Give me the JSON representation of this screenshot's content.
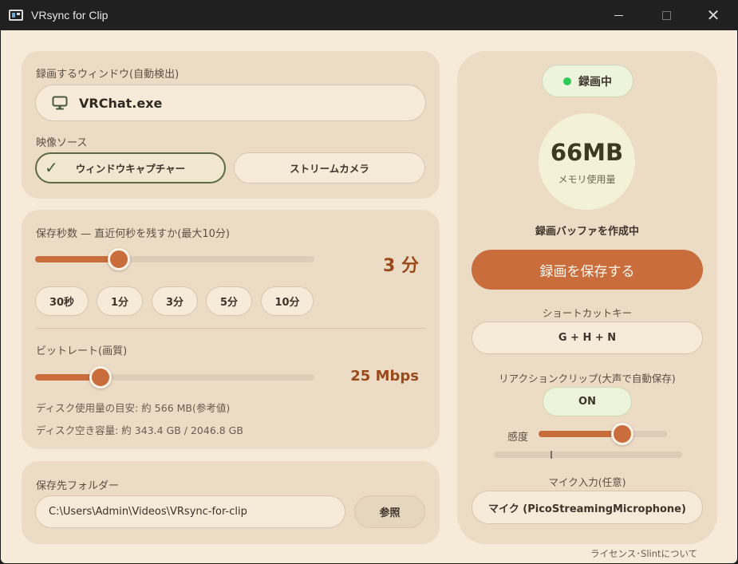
{
  "window": {
    "title": "VRsync for Clip",
    "minimize": "",
    "maximize": "",
    "close": "✕"
  },
  "capture": {
    "window_label": "録画するウィンドウ(自動検出)",
    "window_value": "VRChat.exe",
    "source_label": "映像ソース",
    "source_window_capture": "ウィンドウキャプチャー",
    "source_stream_camera": "ストリームカメラ",
    "selected_source": "ウィンドウキャプチャー",
    "check_glyph": "✓"
  },
  "retention": {
    "label": "保存秒数 — 直近何秒を残すか(最大10分)",
    "value_text": "3 分",
    "value_fraction": 0.3,
    "presets": [
      "30秒",
      "1分",
      "3分",
      "5分",
      "10分"
    ]
  },
  "bitrate": {
    "label": "ビットレート(画質)",
    "value_text": "25 Mbps",
    "value_fraction": 0.234,
    "disk_estimate": "ディスク使用量の目安: 約 566 MB(参考値)",
    "disk_free": "ディスク空き容量: 約 343.4 GB / 2046.8 GB"
  },
  "folder": {
    "label": "保存先フォルダー",
    "path": "C:\\Users\\Admin\\Videos\\VRsync-for-clip",
    "browse": "参照"
  },
  "status": {
    "recording": "録画中",
    "memory_value": "66MB",
    "memory_label": "メモリ使用量",
    "buffer_status": "録画バッファを作成中",
    "save_button": "録画を保存する",
    "indicator_color": "#2ecc57"
  },
  "shortcut": {
    "label": "ショートカットキー",
    "value": "G + H + N"
  },
  "reaction": {
    "label": "リアクションクリップ(大声で自動保存)",
    "toggle": "ON",
    "sensitivity_label": "感度",
    "sensitivity_fraction": 0.65,
    "level_fraction": 0.3
  },
  "mic": {
    "label": "マイク入力(任意)",
    "value": "マイク (PicoStreamingMicrophone)"
  },
  "footer": {
    "license": "ライセンス･Slintについて"
  },
  "colors": {
    "accent": "#c96d3c",
    "background": "#f6ead8",
    "card": "#ecdcc5",
    "value_text": "#9a4a1c"
  }
}
